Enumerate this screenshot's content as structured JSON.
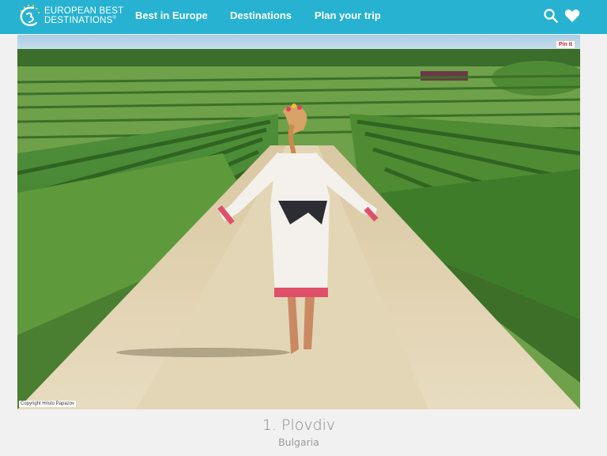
{
  "header": {
    "logo_line1": "European Best",
    "logo_line2": "Destinations",
    "logo_mark": "®",
    "nav": [
      {
        "label": "Best in Europe"
      },
      {
        "label": "Destinations"
      },
      {
        "label": "Plan your trip"
      }
    ],
    "icons": [
      "search-icon",
      "heart-icon",
      "logo-emblem-icon"
    ],
    "color": "#27b2d1"
  },
  "photo": {
    "pin_label": "Pin it",
    "copyright": "Copyright Hristo Papazov"
  },
  "caption": {
    "title": "1. Plovdiv",
    "country": "Bulgaria"
  }
}
